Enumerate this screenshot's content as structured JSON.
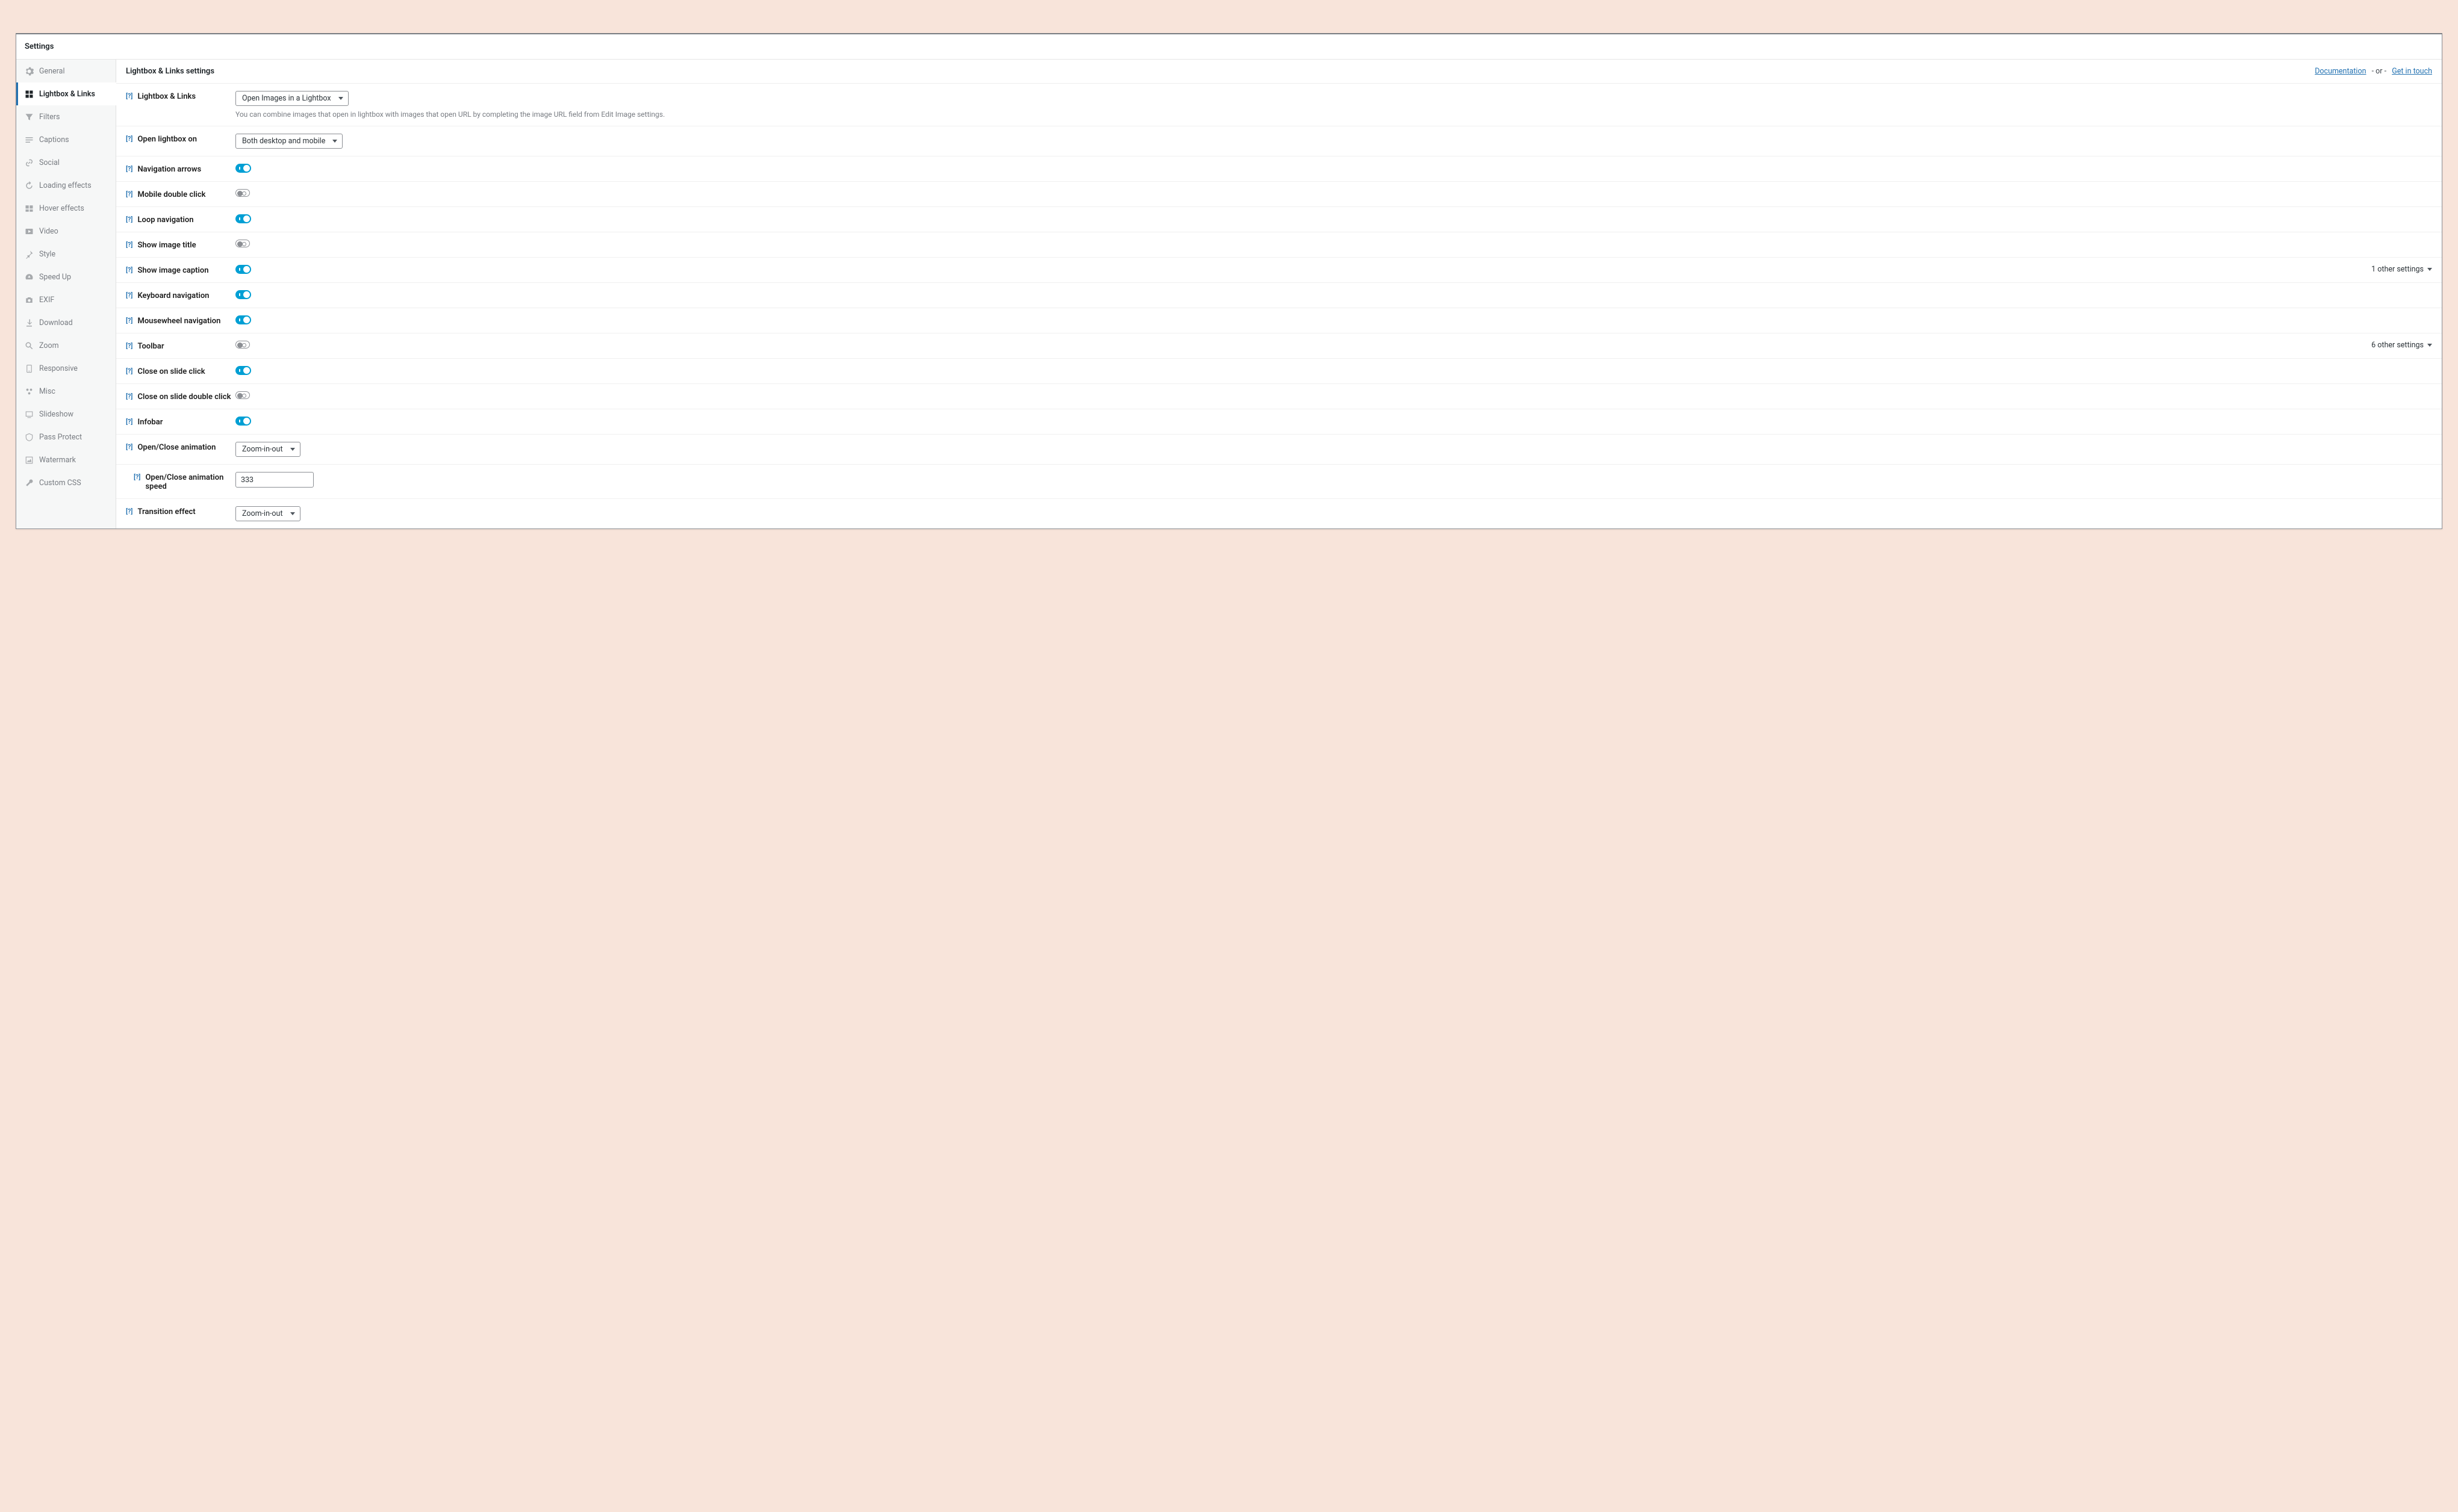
{
  "header": {
    "title": "Settings"
  },
  "sidebar": {
    "items": [
      {
        "id": "general",
        "label": "General"
      },
      {
        "id": "lightbox",
        "label": "Lightbox & Links"
      },
      {
        "id": "filters",
        "label": "Filters"
      },
      {
        "id": "captions",
        "label": "Captions"
      },
      {
        "id": "social",
        "label": "Social"
      },
      {
        "id": "loading",
        "label": "Loading effects"
      },
      {
        "id": "hover",
        "label": "Hover effects"
      },
      {
        "id": "video",
        "label": "Video"
      },
      {
        "id": "style",
        "label": "Style"
      },
      {
        "id": "speedup",
        "label": "Speed Up"
      },
      {
        "id": "exif",
        "label": "EXIF"
      },
      {
        "id": "download",
        "label": "Download"
      },
      {
        "id": "zoom",
        "label": "Zoom"
      },
      {
        "id": "responsive",
        "label": "Responsive"
      },
      {
        "id": "misc",
        "label": "Misc"
      },
      {
        "id": "slideshow",
        "label": "Slideshow"
      },
      {
        "id": "passprotect",
        "label": "Pass Protect"
      },
      {
        "id": "watermark",
        "label": "Watermark"
      },
      {
        "id": "customcss",
        "label": "Custom CSS"
      }
    ]
  },
  "main": {
    "title": "Lightbox & Links settings",
    "doc_link": "Documentation",
    "or_text": "- or -",
    "touch_link": "Get in touch",
    "help_glyph": "[?]"
  },
  "settings": {
    "lightbox_links": {
      "label": "Lightbox & Links",
      "value": "Open Images in a Lightbox",
      "desc": "You can combine images that open in lightbox with images that open URL by completing the image URL field from Edit Image settings."
    },
    "open_on": {
      "label": "Open lightbox on",
      "value": "Both desktop and mobile"
    },
    "nav_arrows": {
      "label": "Navigation arrows",
      "on": true
    },
    "mobile_dbl": {
      "label": "Mobile double click",
      "on": false
    },
    "loop_nav": {
      "label": "Loop navigation",
      "on": true
    },
    "show_title": {
      "label": "Show image title",
      "on": false
    },
    "show_caption": {
      "label": "Show image caption",
      "on": true,
      "extra": "1 other settings"
    },
    "keyboard": {
      "label": "Keyboard navigation",
      "on": true
    },
    "mousewheel": {
      "label": "Mousewheel navigation",
      "on": true
    },
    "toolbar": {
      "label": "Toolbar",
      "on": false,
      "extra": "6 other settings"
    },
    "close_click": {
      "label": "Close on slide click",
      "on": true
    },
    "close_dbl": {
      "label": "Close on slide double click",
      "on": false
    },
    "infobar": {
      "label": "Infobar",
      "on": true
    },
    "open_close_anim": {
      "label": "Open/Close animation",
      "value": "Zoom-in-out"
    },
    "open_close_speed": {
      "label": "Open/Close animation speed",
      "value": "333"
    },
    "transition": {
      "label": "Transition effect",
      "value": "Zoom-in-out"
    }
  }
}
